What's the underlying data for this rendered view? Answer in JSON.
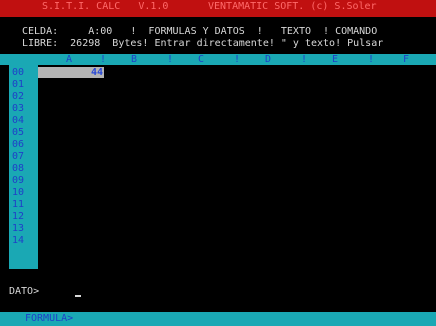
{
  "title_bar": {
    "app_name": "S.I.T.I. CALC   V.1.0",
    "copyright": "VENTAMATIC SOFT. (c) S.Soler"
  },
  "info": {
    "row1": "CELDA:     A:00   !  FORMULAS Y DATOS  !   TEXTO  ! COMANDO",
    "row2": "LIBRE:  26298  Bytes! Entrar directamente! \" y texto! Pulsar"
  },
  "columns": [
    {
      "letter": "A"
    },
    {
      "letter": "B"
    },
    {
      "letter": "C"
    },
    {
      "letter": "D"
    },
    {
      "letter": "E"
    },
    {
      "letter": "F"
    }
  ],
  "column_separator": "!",
  "rows": [
    "00",
    "01",
    "02",
    "03",
    "04",
    "05",
    "06",
    "07",
    "08",
    "09",
    "10",
    "11",
    "12",
    "13",
    "14"
  ],
  "active_cell": {
    "value": "44"
  },
  "prompt": {
    "label": "DATO>"
  },
  "status_bar": {
    "mode": "FORMULA>"
  },
  "colors": {
    "title_bg": "#c01010",
    "title_text": "#ff6a6a",
    "header_bg": "#1aa8b4",
    "header_text": "#1f40c8",
    "cell_highlight": "#b4b4b4",
    "cell_value": "#2848d8",
    "background": "#000000",
    "text": "#d8d8d8"
  }
}
